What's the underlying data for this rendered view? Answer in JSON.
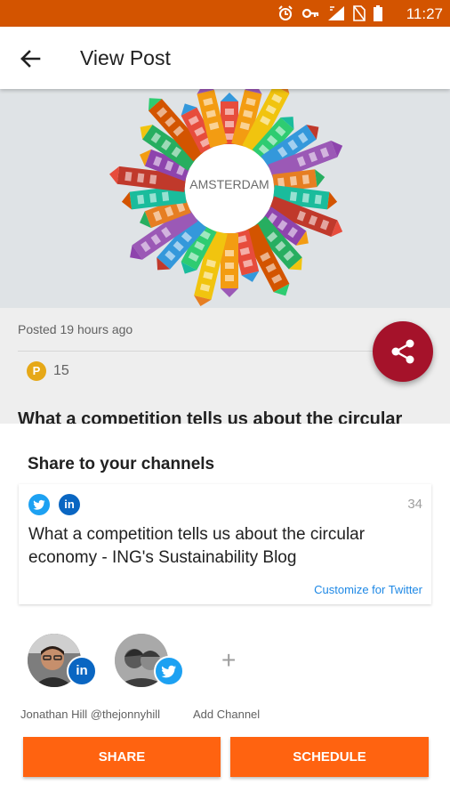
{
  "status_bar": {
    "time": "11:27",
    "icons": [
      "alarm-icon",
      "key-icon",
      "signal-icon",
      "no-sim-icon",
      "battery-icon"
    ],
    "background": "#d35400"
  },
  "app_bar": {
    "title": "View Post",
    "back_icon": "back-arrow-icon"
  },
  "hero": {
    "image_text": "AMSTERDAM"
  },
  "post": {
    "posted": "Posted 19 hours ago",
    "points_icon_label": "P",
    "points": "15",
    "heading": "What a competition tells us about the circular"
  },
  "fab": {
    "icon": "share-icon",
    "color": "#a5122a"
  },
  "share_sheet": {
    "title": "Share to your channels",
    "card": {
      "networks": [
        "twitter-icon",
        "linkedin-icon"
      ],
      "linkedin_label": "in",
      "char_count": "34",
      "text": "What a competition tells us about the circular economy - ING's Sustainability Blog",
      "customize_link": "Customize for Twitter"
    },
    "accounts": [
      {
        "network": "linkedin",
        "badge_label": "in",
        "name": "Jonathan Hill"
      },
      {
        "network": "twitter",
        "name": "@thejonnyhill"
      }
    ],
    "account_names": "Jonathan Hill @thejonnyhill",
    "add_channel_icon": "+",
    "add_channel_label": "Add Channel",
    "buttons": {
      "share": "SHARE",
      "schedule": "SCHEDULE"
    },
    "accent_color": "#ff6310"
  }
}
